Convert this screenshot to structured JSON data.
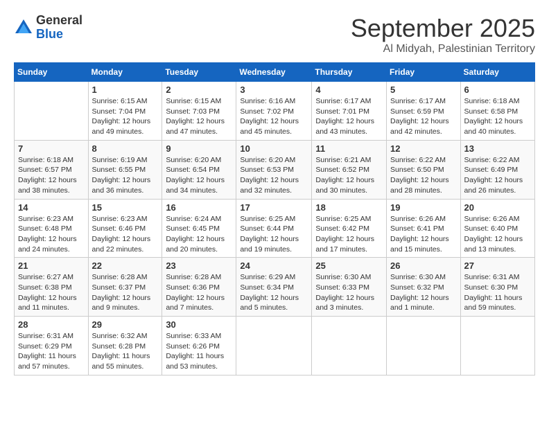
{
  "header": {
    "logo_general": "General",
    "logo_blue": "Blue",
    "month_title": "September 2025",
    "location": "Al Midyah, Palestinian Territory"
  },
  "days_of_week": [
    "Sunday",
    "Monday",
    "Tuesday",
    "Wednesday",
    "Thursday",
    "Friday",
    "Saturday"
  ],
  "weeks": [
    [
      {
        "day": "",
        "info": ""
      },
      {
        "day": "1",
        "info": "Sunrise: 6:15 AM\nSunset: 7:04 PM\nDaylight: 12 hours\nand 49 minutes."
      },
      {
        "day": "2",
        "info": "Sunrise: 6:15 AM\nSunset: 7:03 PM\nDaylight: 12 hours\nand 47 minutes."
      },
      {
        "day": "3",
        "info": "Sunrise: 6:16 AM\nSunset: 7:02 PM\nDaylight: 12 hours\nand 45 minutes."
      },
      {
        "day": "4",
        "info": "Sunrise: 6:17 AM\nSunset: 7:01 PM\nDaylight: 12 hours\nand 43 minutes."
      },
      {
        "day": "5",
        "info": "Sunrise: 6:17 AM\nSunset: 6:59 PM\nDaylight: 12 hours\nand 42 minutes."
      },
      {
        "day": "6",
        "info": "Sunrise: 6:18 AM\nSunset: 6:58 PM\nDaylight: 12 hours\nand 40 minutes."
      }
    ],
    [
      {
        "day": "7",
        "info": "Sunrise: 6:18 AM\nSunset: 6:57 PM\nDaylight: 12 hours\nand 38 minutes."
      },
      {
        "day": "8",
        "info": "Sunrise: 6:19 AM\nSunset: 6:55 PM\nDaylight: 12 hours\nand 36 minutes."
      },
      {
        "day": "9",
        "info": "Sunrise: 6:20 AM\nSunset: 6:54 PM\nDaylight: 12 hours\nand 34 minutes."
      },
      {
        "day": "10",
        "info": "Sunrise: 6:20 AM\nSunset: 6:53 PM\nDaylight: 12 hours\nand 32 minutes."
      },
      {
        "day": "11",
        "info": "Sunrise: 6:21 AM\nSunset: 6:52 PM\nDaylight: 12 hours\nand 30 minutes."
      },
      {
        "day": "12",
        "info": "Sunrise: 6:22 AM\nSunset: 6:50 PM\nDaylight: 12 hours\nand 28 minutes."
      },
      {
        "day": "13",
        "info": "Sunrise: 6:22 AM\nSunset: 6:49 PM\nDaylight: 12 hours\nand 26 minutes."
      }
    ],
    [
      {
        "day": "14",
        "info": "Sunrise: 6:23 AM\nSunset: 6:48 PM\nDaylight: 12 hours\nand 24 minutes."
      },
      {
        "day": "15",
        "info": "Sunrise: 6:23 AM\nSunset: 6:46 PM\nDaylight: 12 hours\nand 22 minutes."
      },
      {
        "day": "16",
        "info": "Sunrise: 6:24 AM\nSunset: 6:45 PM\nDaylight: 12 hours\nand 20 minutes."
      },
      {
        "day": "17",
        "info": "Sunrise: 6:25 AM\nSunset: 6:44 PM\nDaylight: 12 hours\nand 19 minutes."
      },
      {
        "day": "18",
        "info": "Sunrise: 6:25 AM\nSunset: 6:42 PM\nDaylight: 12 hours\nand 17 minutes."
      },
      {
        "day": "19",
        "info": "Sunrise: 6:26 AM\nSunset: 6:41 PM\nDaylight: 12 hours\nand 15 minutes."
      },
      {
        "day": "20",
        "info": "Sunrise: 6:26 AM\nSunset: 6:40 PM\nDaylight: 12 hours\nand 13 minutes."
      }
    ],
    [
      {
        "day": "21",
        "info": "Sunrise: 6:27 AM\nSunset: 6:38 PM\nDaylight: 12 hours\nand 11 minutes."
      },
      {
        "day": "22",
        "info": "Sunrise: 6:28 AM\nSunset: 6:37 PM\nDaylight: 12 hours\nand 9 minutes."
      },
      {
        "day": "23",
        "info": "Sunrise: 6:28 AM\nSunset: 6:36 PM\nDaylight: 12 hours\nand 7 minutes."
      },
      {
        "day": "24",
        "info": "Sunrise: 6:29 AM\nSunset: 6:34 PM\nDaylight: 12 hours\nand 5 minutes."
      },
      {
        "day": "25",
        "info": "Sunrise: 6:30 AM\nSunset: 6:33 PM\nDaylight: 12 hours\nand 3 minutes."
      },
      {
        "day": "26",
        "info": "Sunrise: 6:30 AM\nSunset: 6:32 PM\nDaylight: 12 hours\nand 1 minute."
      },
      {
        "day": "27",
        "info": "Sunrise: 6:31 AM\nSunset: 6:30 PM\nDaylight: 11 hours\nand 59 minutes."
      }
    ],
    [
      {
        "day": "28",
        "info": "Sunrise: 6:31 AM\nSunset: 6:29 PM\nDaylight: 11 hours\nand 57 minutes."
      },
      {
        "day": "29",
        "info": "Sunrise: 6:32 AM\nSunset: 6:28 PM\nDaylight: 11 hours\nand 55 minutes."
      },
      {
        "day": "30",
        "info": "Sunrise: 6:33 AM\nSunset: 6:26 PM\nDaylight: 11 hours\nand 53 minutes."
      },
      {
        "day": "",
        "info": ""
      },
      {
        "day": "",
        "info": ""
      },
      {
        "day": "",
        "info": ""
      },
      {
        "day": "",
        "info": ""
      }
    ]
  ]
}
